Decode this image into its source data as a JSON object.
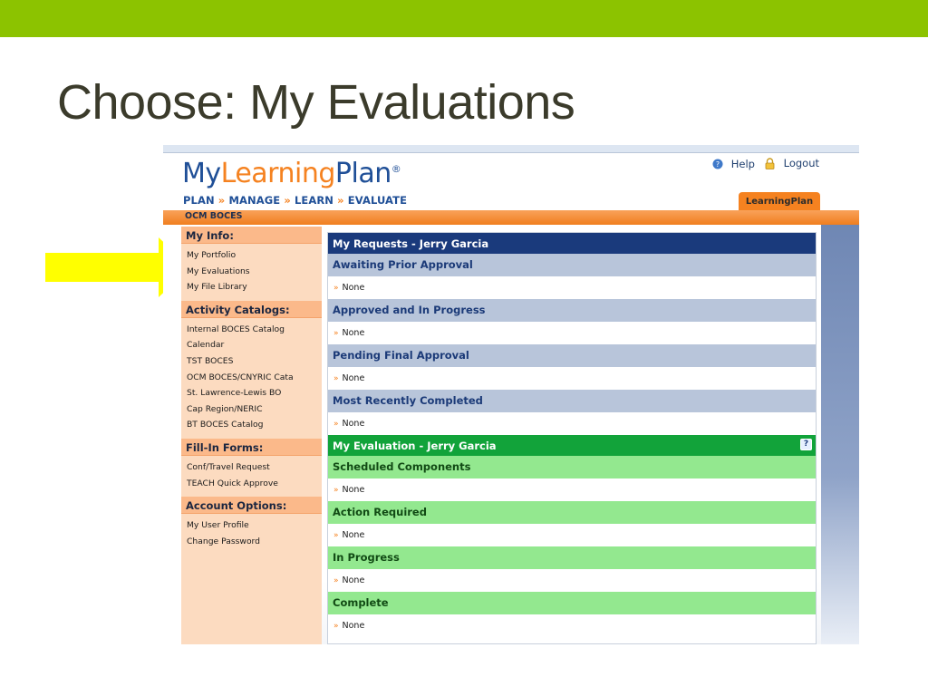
{
  "slide": {
    "title": "Choose: My Evaluations",
    "accent_color": "#8cc300",
    "arrow_color": "#ffff00"
  },
  "app": {
    "logo": {
      "my": "My",
      "learning": "Learning",
      "plan": "Plan",
      "reg": "®"
    },
    "tagline": {
      "plan": "PLAN",
      "manage": "MANAGE",
      "learn": "LEARN",
      "evaluate": "EVALUATE",
      "sep": "»"
    },
    "toplinks": {
      "help": "Help",
      "logout": "Logout"
    },
    "tab": "LearningPlan",
    "org": "OCM BOCES",
    "brand_orange": "#f58220",
    "brand_blue": "#1f4f97"
  },
  "sidebar": {
    "sections": [
      {
        "heading": "My Info:",
        "items": [
          "My Portfolio",
          "My Evaluations",
          "My File Library"
        ]
      },
      {
        "heading": "Activity Catalogs:",
        "items": [
          "Internal BOCES Catalog",
          "Calendar",
          "TST BOCES",
          "OCM BOCES/CNYRIC Cata",
          "St. Lawrence-Lewis BO",
          "Cap Region/NERIC",
          "BT BOCES Catalog"
        ]
      },
      {
        "heading": "Fill-In Forms:",
        "items": [
          "Conf/Travel Request",
          "TEACH Quick Approve"
        ]
      },
      {
        "heading": "Account Options:",
        "items": [
          "My User Profile",
          "Change Password"
        ]
      }
    ]
  },
  "requests": {
    "title": "My Requests - Jerry Garcia",
    "sections": [
      {
        "heading": "Awaiting Prior Approval",
        "value": "None"
      },
      {
        "heading": "Approved and In Progress",
        "value": "None"
      },
      {
        "heading": "Pending Final Approval",
        "value": "None"
      },
      {
        "heading": "Most Recently Completed",
        "value": "None"
      }
    ]
  },
  "evaluation": {
    "title": "My Evaluation - Jerry Garcia",
    "help": "?",
    "sections": [
      {
        "heading": "Scheduled Components",
        "value": "None"
      },
      {
        "heading": "Action Required",
        "value": "None"
      },
      {
        "heading": "In Progress",
        "value": "None"
      },
      {
        "heading": "Complete",
        "value": "None"
      }
    ]
  },
  "bullet": "»"
}
